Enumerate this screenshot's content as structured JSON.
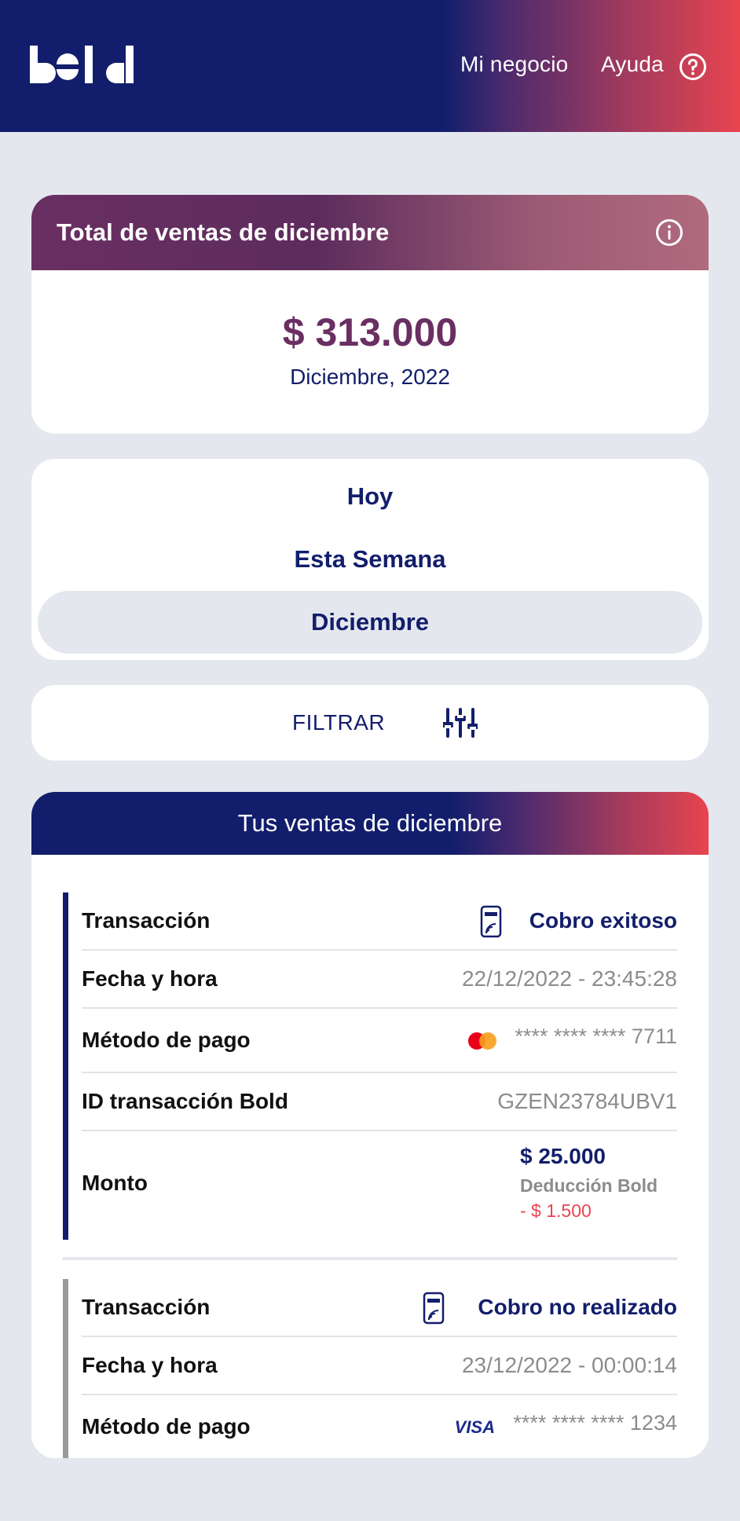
{
  "header": {
    "logo_alt": "bold",
    "nav": [
      "Mi negocio",
      "Ayuda"
    ],
    "help_icon": "question-circle-icon",
    "colors": {
      "navy": "#121e6c",
      "accent": "#e8444f",
      "plum": "#6a2f62"
    }
  },
  "total": {
    "title": "Total de ventas de diciembre",
    "amount": "$ 313.000",
    "date": "Diciembre, 2022",
    "info_icon": "info-icon"
  },
  "periods": {
    "options": [
      "Hoy",
      "Esta Semana",
      "Diciembre"
    ],
    "selected": "Diciembre"
  },
  "filter": {
    "label": "FILTRAR",
    "icon": "sliders-icon"
  },
  "sales": {
    "title": "Tus ventas de diciembre",
    "labels": {
      "transaction": "Transacción",
      "datetime": "Fecha y hora",
      "method": "Método de pago",
      "id": "ID transacción Bold",
      "amount": "Monto"
    },
    "transactions": [
      {
        "status": "Cobro exitoso",
        "datetime": "22/12/2022 - 23:45:28",
        "card_masked": "**** **** **** 7711",
        "card_brand": "mastercard",
        "id": "GZEN23784UBV1",
        "amount": "$ 25.000",
        "deduction_label": "Deducción Bold",
        "deduction": "- $ 1.500",
        "bar_color": "#121e6c"
      },
      {
        "status": "Cobro no realizado",
        "datetime": "23/12/2022 - 00:00:14",
        "card_masked": "**** **** **** 1234",
        "card_brand": "VISA",
        "bar_color": "#9a9a9a"
      }
    ]
  }
}
